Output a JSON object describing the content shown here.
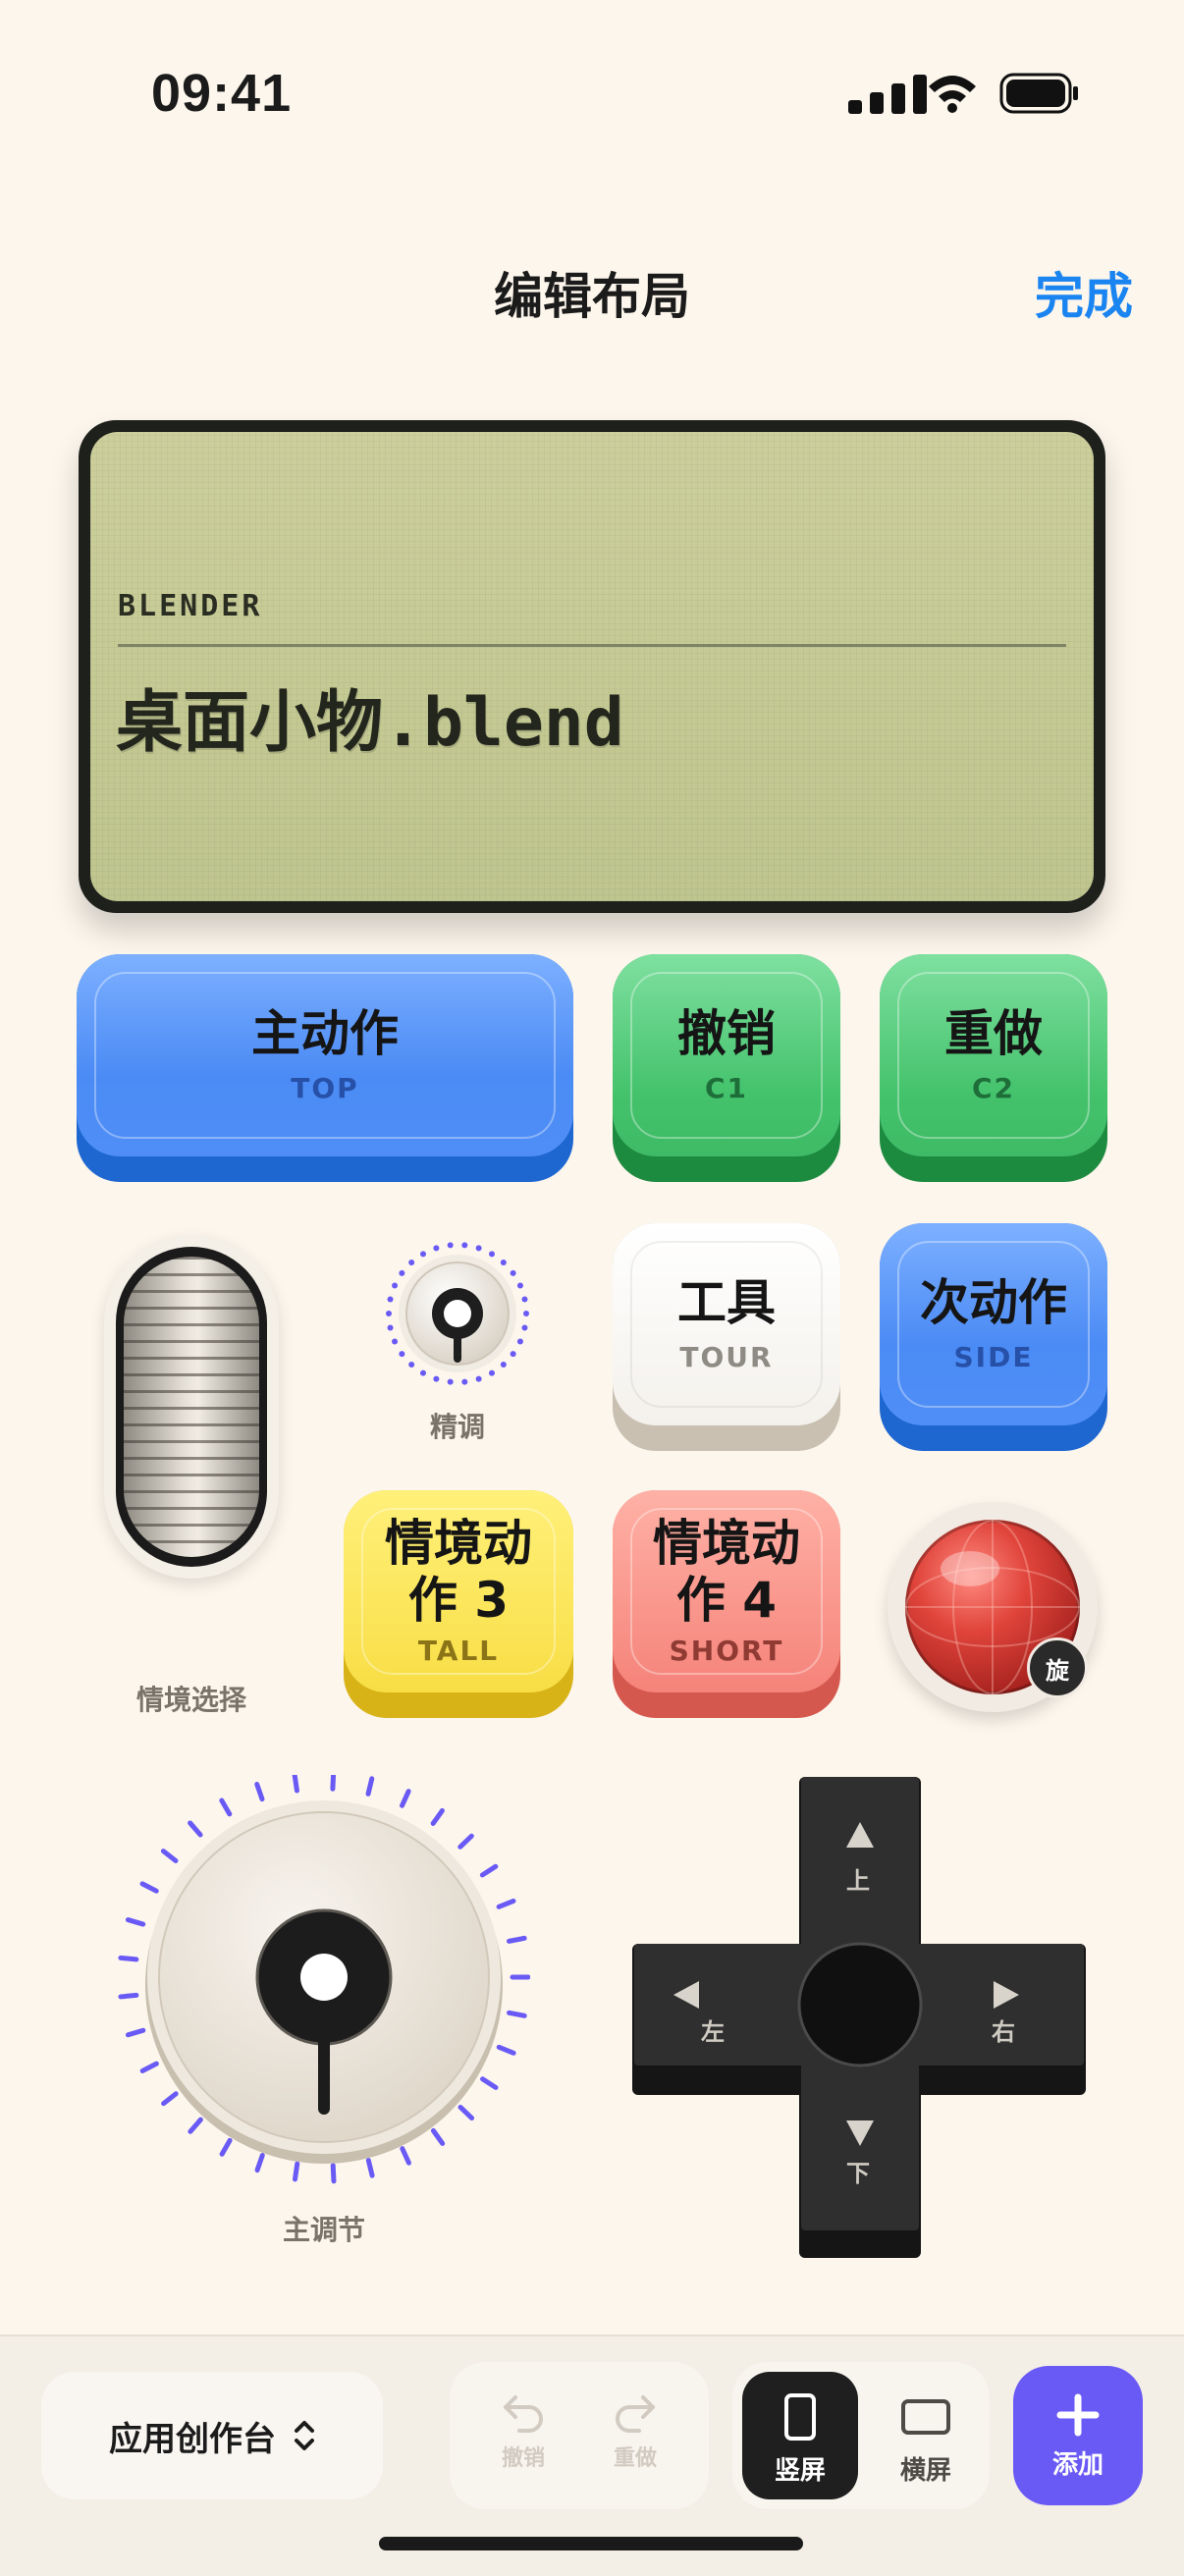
{
  "status_bar": {
    "time": "09:41"
  },
  "nav": {
    "title": "编辑布局",
    "done": "完成"
  },
  "display": {
    "app": "BLENDER",
    "file": "桌面小物.blend"
  },
  "keys": {
    "primary": {
      "label": "主动作",
      "sub": "TOP"
    },
    "undo": {
      "label": "撤销",
      "sub": "C1"
    },
    "redo": {
      "label": "重做",
      "sub": "C2"
    },
    "tool": {
      "label": "工具",
      "sub": "TOUR"
    },
    "secondary": {
      "label": "次动作",
      "sub": "SIDE"
    },
    "context3": {
      "label_line1": "情境动",
      "label_line2": "作 3",
      "sub": "TALL"
    },
    "context4": {
      "label_line1": "情境动",
      "label_line2": "作 4",
      "sub": "SHORT"
    }
  },
  "controls": {
    "fine_knob_label": "精调",
    "slider_label": "情境选择",
    "trackball_badge": "旋",
    "main_knob_label": "主调节",
    "dpad": {
      "up": "上",
      "down": "下",
      "left": "左",
      "right": "右"
    }
  },
  "bottom_bar": {
    "app_selector": "应用创作台",
    "undo": "撤销",
    "redo": "重做",
    "portrait": "竖屏",
    "landscape": "横屏",
    "add": "添加"
  },
  "colors": {
    "accent_blue": "#1A84F1",
    "add_purple": "#6A5AF5",
    "tick_purple": "#6A5AF5",
    "lcd": "#C6CA94"
  },
  "icons": [
    "signal-icon",
    "wifi-icon",
    "battery-icon",
    "chevron-updown-icon",
    "undo-icon",
    "redo-icon",
    "portrait-icon",
    "landscape-icon",
    "plus-icon",
    "triangle-up-icon",
    "triangle-down-icon",
    "triangle-left-icon",
    "triangle-right-icon"
  ]
}
